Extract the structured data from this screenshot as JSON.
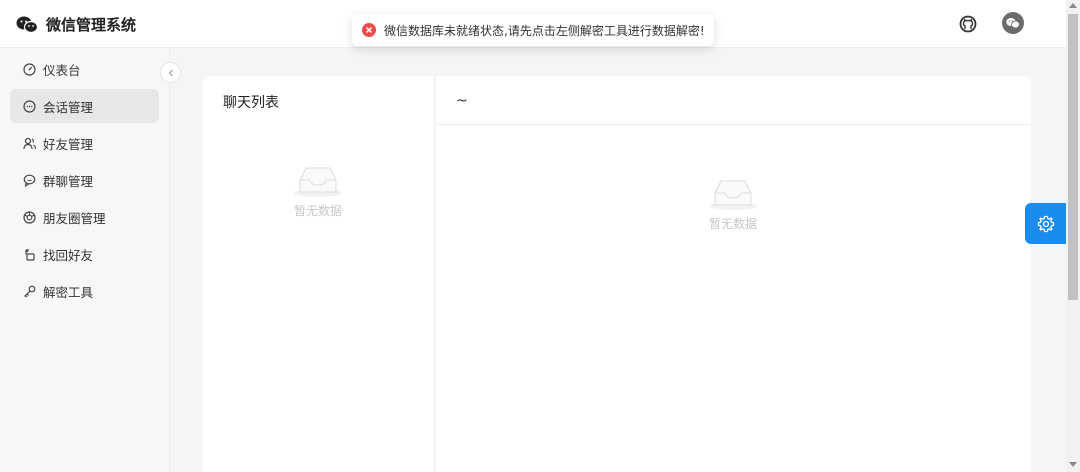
{
  "header": {
    "title": "微信管理系统",
    "github_icon": "github-icon",
    "avatar_icon": "wechat-icon"
  },
  "toast": {
    "type": "error",
    "icon": "close-circle-icon",
    "message": "微信数据库未就绪状态,请先点击左侧解密工具进行数据解密!"
  },
  "sidebar": {
    "items": [
      {
        "label": "仪表台",
        "icon": "dashboard-icon",
        "active": false
      },
      {
        "label": "会话管理",
        "icon": "chat-bubble-icon",
        "active": true
      },
      {
        "label": "好友管理",
        "icon": "users-icon",
        "active": false
      },
      {
        "label": "群聊管理",
        "icon": "group-chat-icon",
        "active": false
      },
      {
        "label": "朋友圈管理",
        "icon": "moments-icon",
        "active": false
      },
      {
        "label": "找回好友",
        "icon": "recover-icon",
        "active": false
      },
      {
        "label": "解密工具",
        "icon": "key-icon",
        "active": false
      }
    ]
  },
  "chat_list": {
    "title": "聊天列表",
    "empty_text": "暂无数据"
  },
  "chat_main": {
    "title": "~",
    "empty_text": "暂无数据"
  },
  "colors": {
    "accent": "#1a8cf0",
    "error": "#f04a4a",
    "active_bg": "#e7e7e7"
  }
}
